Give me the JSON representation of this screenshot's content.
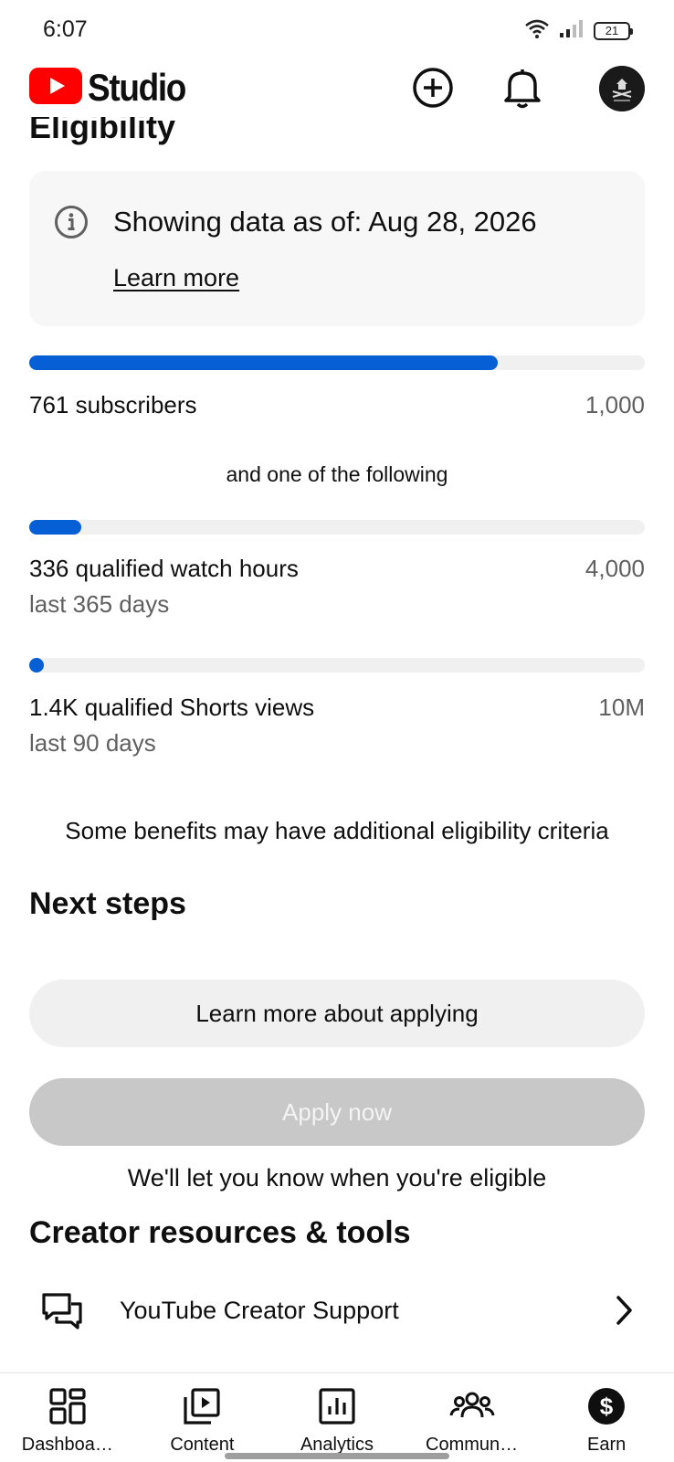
{
  "status_bar": {
    "time": "6:07",
    "battery": "21"
  },
  "header": {
    "app_name": "Studio"
  },
  "section_partial_title": "Eligibility",
  "info_card": {
    "title": "Showing data as of: Aug 28, 2026",
    "link": "Learn more"
  },
  "requirements": {
    "subscribers": {
      "label": "761 subscribers",
      "target": "1,000",
      "progress": 0.761
    },
    "connector": "and one of the following",
    "watch_hours": {
      "label": "336 qualified watch hours",
      "target": "4,000",
      "sublabel": "last 365 days",
      "progress": 0.084
    },
    "shorts_views": {
      "label": "1.4K qualified Shorts views",
      "target": "10M",
      "sublabel": "last 90 days",
      "progress": 0.00014
    }
  },
  "benefits_note": "Some benefits may have additional eligibility criteria",
  "next_steps": {
    "heading": "Next steps",
    "learn_button": "Learn more about applying",
    "apply_button": "Apply now",
    "eligibility_note": "We'll let you know when you're eligible"
  },
  "resources": {
    "heading": "Creator resources & tools",
    "items": [
      {
        "label": "YouTube Creator Support"
      }
    ]
  },
  "bottom_nav": {
    "items": [
      {
        "label": "Dashboa…"
      },
      {
        "label": "Content"
      },
      {
        "label": "Analytics"
      },
      {
        "label": "Commun…"
      },
      {
        "label": "Earn"
      }
    ]
  },
  "colors": {
    "brand_red": "#ff0000",
    "progress_blue": "#065fd4"
  }
}
